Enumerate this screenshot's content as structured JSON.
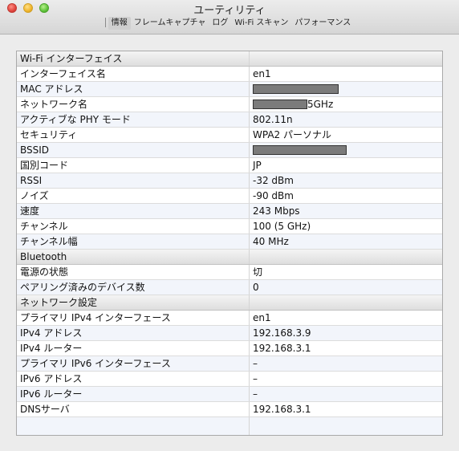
{
  "window": {
    "title": "ユーティリティ"
  },
  "toolbar": {
    "tabs": [
      "情報",
      "フレームキャプチャ",
      "ログ",
      "Wi-Fi スキャン",
      "パフォーマンス"
    ]
  },
  "sections": {
    "wifi": {
      "title": "Wi-Fi インターフェイス",
      "rows": [
        {
          "key": "インターフェイス名",
          "value": "en1"
        },
        {
          "key": "MAC アドレス",
          "value": ""
        },
        {
          "key": "ネットワーク名",
          "value": "5GHz"
        },
        {
          "key": "アクティブな PHY モード",
          "value": "802.11n"
        },
        {
          "key": "セキュリティ",
          "value": "WPA2 パーソナル"
        },
        {
          "key": "BSSID",
          "value": ""
        },
        {
          "key": "国別コード",
          "value": "JP"
        },
        {
          "key": "RSSI",
          "value": "-32 dBm"
        },
        {
          "key": "ノイズ",
          "value": "-90 dBm"
        },
        {
          "key": "速度",
          "value": "243 Mbps"
        },
        {
          "key": "チャンネル",
          "value": "100 (5 GHz)"
        },
        {
          "key": "チャンネル幅",
          "value": "40 MHz"
        }
      ]
    },
    "bluetooth": {
      "title": "Bluetooth",
      "rows": [
        {
          "key": "電源の状態",
          "value": "切"
        },
        {
          "key": "ペアリング済みのデバイス数",
          "value": "0"
        }
      ]
    },
    "network": {
      "title": "ネットワーク設定",
      "rows": [
        {
          "key": "プライマリ IPv4 インターフェース",
          "value": "en1"
        },
        {
          "key": "IPv4 アドレス",
          "value": "192.168.3.9"
        },
        {
          "key": "IPv4 ルーター",
          "value": "192.168.3.1"
        },
        {
          "key": "プライマリ IPv6 インターフェース",
          "value": "–"
        },
        {
          "key": "IPv6 アドレス",
          "value": "–"
        },
        {
          "key": "IPv6 ルーター",
          "value": "–"
        },
        {
          "key": "DNSサーバ",
          "value": "192.168.3.1"
        }
      ]
    }
  }
}
